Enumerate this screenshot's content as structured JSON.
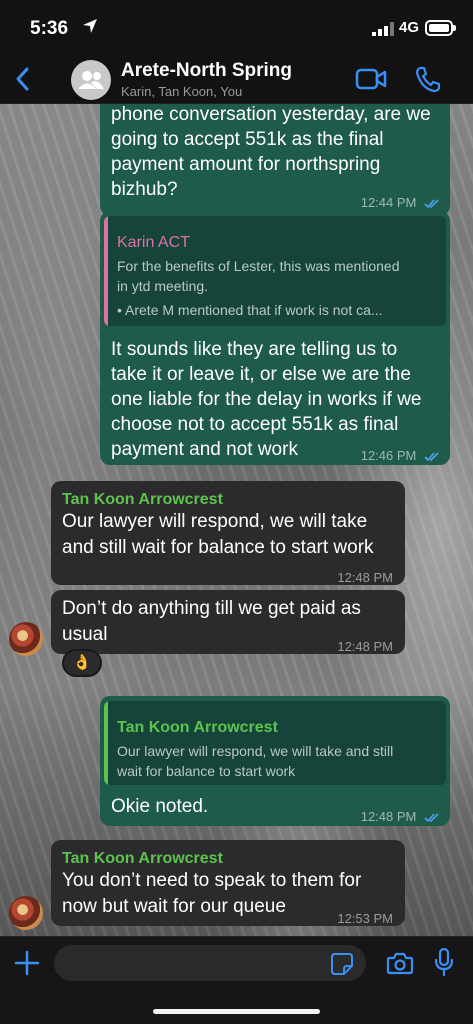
{
  "status_bar": {
    "time": "5:36",
    "network": "4G"
  },
  "header": {
    "title": "Arete-North Spring",
    "members": "Karin, Tan Koon, You"
  },
  "messages": {
    "m1": {
      "lines": [
        "phone conversation yesterday, are we",
        "going to accept 551k as the final",
        "payment amount for northspring",
        "bizhub?"
      ],
      "time": "12:44 PM"
    },
    "m2": {
      "quote_sender": "Karin ACT",
      "quote_lines": [
        "For the benefits of Lester, this was mentioned",
        "in ytd meeting.",
        "•      Arete M mentioned that if work is not ca..."
      ],
      "lines": [
        "It sounds like they are telling us to",
        "take it or leave it, or else we are the",
        "one liable for the delay in works if we",
        "choose not to accept 551k as final",
        "payment and not work"
      ],
      "time": "12:46 PM"
    },
    "m3": {
      "sender": "Tan Koon Arrowcrest",
      "lines": [
        "Our lawyer will respond, we will take",
        "and still wait for balance to start work"
      ],
      "time": "12:48 PM"
    },
    "m4": {
      "lines": [
        "Don’t do anything till we get paid as",
        "usual"
      ],
      "time": "12:48 PM",
      "reaction": "👌"
    },
    "m5": {
      "quote_sender": "Tan Koon Arrowcrest",
      "quote_lines": [
        "Our lawyer will respond, we will take and still",
        "wait for balance to start work"
      ],
      "lines": [
        "Okie noted."
      ],
      "time": "12:48 PM"
    },
    "m6": {
      "sender": "Tan Koon Arrowcrest",
      "lines": [
        "You don’t need to speak to them for",
        "now but wait for our queue"
      ],
      "time": "12:53 PM"
    }
  },
  "colors": {
    "accent": "#3a8ff5",
    "outgoing_bubble": "#1e5b4a",
    "incoming_bubble": "#2b2b2d",
    "sender_green": "#5ec34c",
    "quote_pink": "#d9739f"
  },
  "icons": [
    "location-arrow-icon",
    "signal-icon",
    "battery-icon",
    "back-chevron-icon",
    "group-avatar-icon",
    "video-call-icon",
    "phone-call-icon",
    "read-ticks-icon",
    "plus-icon",
    "sticker-icon",
    "camera-icon",
    "mic-icon"
  ]
}
